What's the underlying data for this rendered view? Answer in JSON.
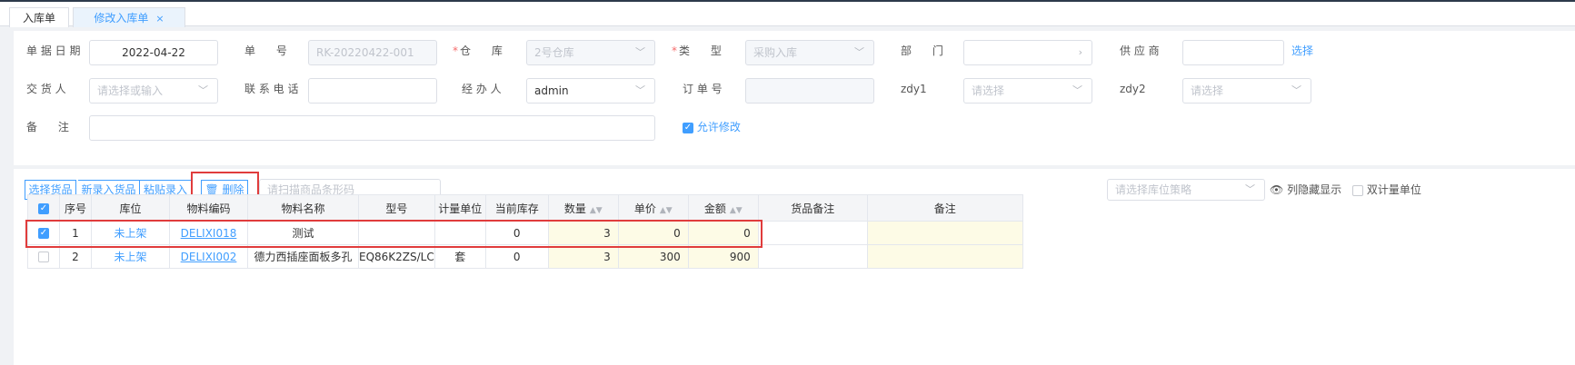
{
  "tabs": [
    {
      "label": "入库单"
    },
    {
      "label": "修改入库单",
      "close": "×"
    }
  ],
  "form": {
    "date_label": "单 据 日 期",
    "date_value": "2022-04-22",
    "no_label": "单      号",
    "no_value": "RK-20220422-001",
    "warehouse_label": "仓      库",
    "warehouse_value": "2号仓库",
    "type_label": "类      型",
    "type_value": "采购入库",
    "dept_label": "部      门",
    "supplier_label": "供 应 商",
    "supplier_select": "选择",
    "deliverer_label": "交 货 人",
    "deliverer_placeholder": "请选择或输入",
    "phone_label": "联 系 电 话",
    "handler_label": "经 办 人",
    "handler_value": "admin",
    "order_label": "订 单 号",
    "zdy1_label": "zdy1",
    "zdy1_placeholder": "请选择",
    "zdy2_label": "zdy2",
    "zdy2_placeholder": "请选择",
    "remark_label": "备      注",
    "allow_edit_label": "允许修改"
  },
  "toolbar": {
    "select_goods": "选择货品",
    "new_entry": "新录入货品",
    "paste_entry": "粘贴录入",
    "delete": "删除",
    "barcode_placeholder": "请扫描商品条形码",
    "location_placeholder": "请选择库位策略",
    "hide_columns": "列隐藏显示",
    "dual_unit": "双计量单位"
  },
  "table": {
    "headers": [
      "序号",
      "库位",
      "物料编码",
      "物料名称",
      "型号",
      "计量单位",
      "当前库存",
      "数量",
      "单价",
      "金额",
      "货品备注",
      "备注"
    ],
    "rows": [
      {
        "seq": "1",
        "location": "未上架",
        "code": "DELIXI018",
        "name": "测试",
        "model": "",
        "unit": "",
        "stock": "0",
        "qty": "3",
        "price": "0",
        "amount": "0",
        "goods_remark": "",
        "remark": ""
      },
      {
        "seq": "2",
        "location": "未上架",
        "code": "DELIXI002",
        "name": "德力西插座面板多孔",
        "model": "EQ86K2ZS/LC",
        "unit": "套",
        "stock": "0",
        "qty": "3",
        "price": "300",
        "amount": "900",
        "goods_remark": "",
        "remark": ""
      }
    ]
  },
  "colors": {
    "accent": "#409eff",
    "highlight": "#e03c3c",
    "editable_cell": "#fdfbe6"
  }
}
